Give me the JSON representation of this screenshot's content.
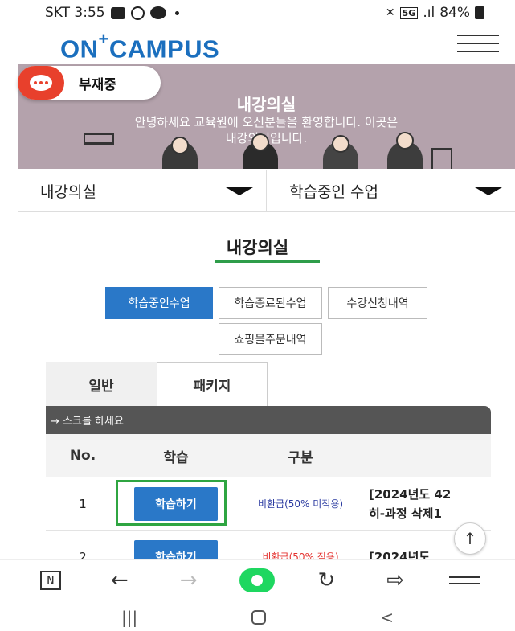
{
  "status_bar": {
    "carrier_time": "SKT 3:55",
    "battery": "84%",
    "signal_text": ".ıl"
  },
  "header": {
    "logo_main": "ON",
    "logo_plus": "+",
    "logo_rest": "CAMPUS"
  },
  "chat": {
    "label": "부재중"
  },
  "banner": {
    "title": "내강의실",
    "line1": "안녕하세요 교육원에 오신분들을 환영합니다. 이곳은",
    "line2": "내강의실입니다."
  },
  "dropdowns": [
    {
      "label": "내강의실"
    },
    {
      "label": "학습중인 수업"
    }
  ],
  "section": {
    "title": "내강의실"
  },
  "tab_buttons": [
    {
      "label": "학습중인수업",
      "active": true
    },
    {
      "label": "학습종료된수업",
      "active": false
    },
    {
      "label": "수강신청내역",
      "active": false
    },
    {
      "label": "쇼핑몰주문내역",
      "active": false
    }
  ],
  "type_tabs": [
    {
      "label": "일반"
    },
    {
      "label": "패키지"
    }
  ],
  "scroll_hint": "→ 스크롤 하세요",
  "table": {
    "headers": [
      "No.",
      "학습",
      "구분"
    ],
    "rows": [
      {
        "no": "1",
        "button": "학습하기",
        "type": "비환급(50% 미적용)",
        "title_line1": "[2024년도 42",
        "title_line2": "히-과정 삭제1"
      },
      {
        "no": "2",
        "button": "학습하기",
        "type": "비환급(50% 적용)",
        "title_line1": "[2024년도",
        "title_line2": ""
      }
    ]
  },
  "colors": {
    "brand_blue": "#1b6fbe",
    "button_blue": "#2a78c8",
    "highlight_green": "#2fa541",
    "banner_bg": "#b4a2ac",
    "chat_red": "#e8402c"
  }
}
